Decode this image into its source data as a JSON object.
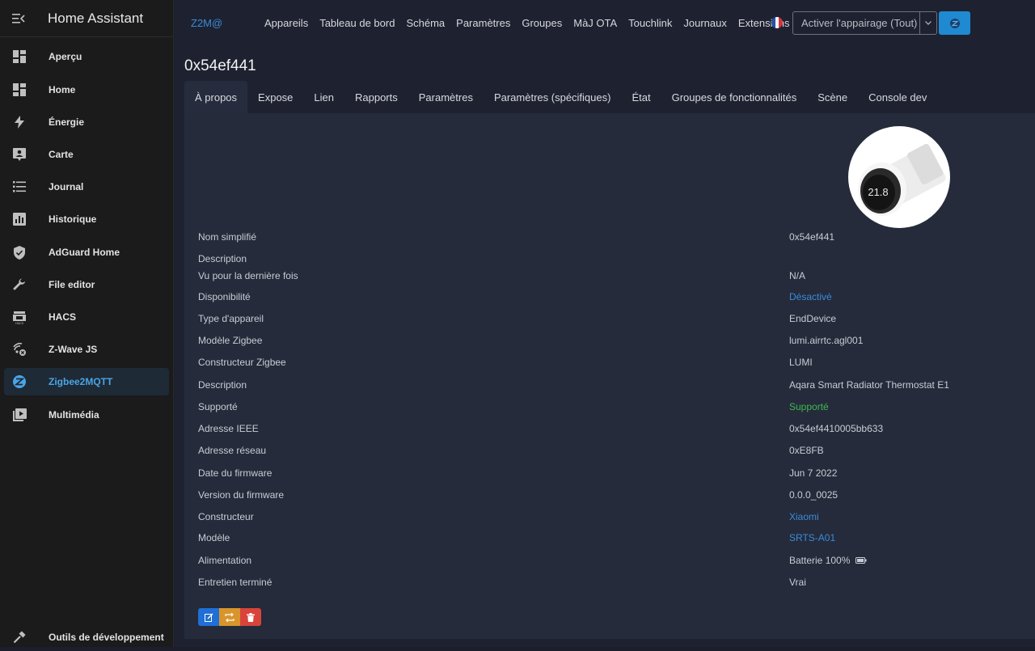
{
  "app": {
    "title": "Home Assistant"
  },
  "sidebar": {
    "items": [
      {
        "label": "Aperçu",
        "icon": "dashboard-icon"
      },
      {
        "label": "Home",
        "icon": "dashboard-icon"
      },
      {
        "label": "Énergie",
        "icon": "lightning-icon"
      },
      {
        "label": "Carte",
        "icon": "map-icon"
      },
      {
        "label": "Journal",
        "icon": "list-icon"
      },
      {
        "label": "Historique",
        "icon": "chart-icon"
      },
      {
        "label": "AdGuard Home",
        "icon": "shield-icon"
      },
      {
        "label": "File editor",
        "icon": "wrench-icon"
      },
      {
        "label": "HACS",
        "icon": "hacs-icon"
      },
      {
        "label": "Z-Wave JS",
        "icon": "zwave-icon"
      },
      {
        "label": "Zigbee2MQTT",
        "icon": "zigbee-icon",
        "active": true
      },
      {
        "label": "Multimédia",
        "icon": "media-icon"
      }
    ],
    "footer": {
      "label": "Outils de développement",
      "icon": "hammer-icon"
    }
  },
  "topbar": {
    "brand": "Z2M@",
    "nav": [
      "Appareils",
      "Tableau de bord",
      "Schéma",
      "Paramètres",
      "Groupes",
      "MàJ OTA",
      "Touchlink",
      "Journaux",
      "Extensions"
    ],
    "pair_select": "Activer l'appairage (Tout)",
    "language_flag": "fr-flag-icon"
  },
  "device": {
    "title": "0x54ef441",
    "tabs": [
      "À propos",
      "Expose",
      "Lien",
      "Rapports",
      "Paramètres",
      "Paramètres (spécifiques)",
      "État",
      "Groupes de fonctionnalités",
      "Scène",
      "Console dev"
    ],
    "active_tab": "À propos",
    "rows": [
      {
        "key": "Nom simplifié",
        "value": "0x54ef441"
      },
      {
        "key": "Description",
        "value": ""
      },
      {
        "key": "Vu pour la dernière fois",
        "value": "N/A"
      },
      {
        "key": "Disponibilité",
        "value": "Désactivé",
        "style": "link"
      },
      {
        "key": "Type d'appareil",
        "value": "EndDevice"
      },
      {
        "key": "Modèle Zigbee",
        "value": "lumi.airrtc.agl001"
      },
      {
        "key": "Constructeur Zigbee",
        "value": "LUMI"
      },
      {
        "key": "Description",
        "value": "Aqara Smart Radiator Thermostat E1"
      },
      {
        "key": "Supporté",
        "value": "Supporté",
        "style": "ok"
      },
      {
        "key": "Adresse IEEE",
        "value": "0x54ef4410005bb633"
      },
      {
        "key": "Adresse réseau",
        "value": "0xE8FB"
      },
      {
        "key": "Date du firmware",
        "value": "Jun 7 2022"
      },
      {
        "key": "Version du firmware",
        "value": "0.0.0_0025"
      },
      {
        "key": "Constructeur",
        "value": "Xiaomi",
        "style": "link"
      },
      {
        "key": "Modèle",
        "value": "SRTS-A01",
        "style": "link"
      },
      {
        "key": "Alimentation",
        "value": "Batterie 100%",
        "icon": "battery-icon"
      },
      {
        "key": "Entretien terminé",
        "value": "Vrai"
      }
    ],
    "photo_readout": "21.8",
    "actions": [
      {
        "name": "edit-button",
        "icon": "edit-icon",
        "color": "#1f6fd6"
      },
      {
        "name": "reconfigure-button",
        "icon": "refresh-icon",
        "color": "#d9952b"
      },
      {
        "name": "delete-button",
        "icon": "trash-icon",
        "color": "#d9443a"
      }
    ]
  },
  "colors": {
    "accent": "#3b8bd8",
    "ok": "#3fb950",
    "sidebar_bg": "#1b1b1b",
    "main_bg": "#1e2230",
    "panel_bg": "#252b3b"
  }
}
